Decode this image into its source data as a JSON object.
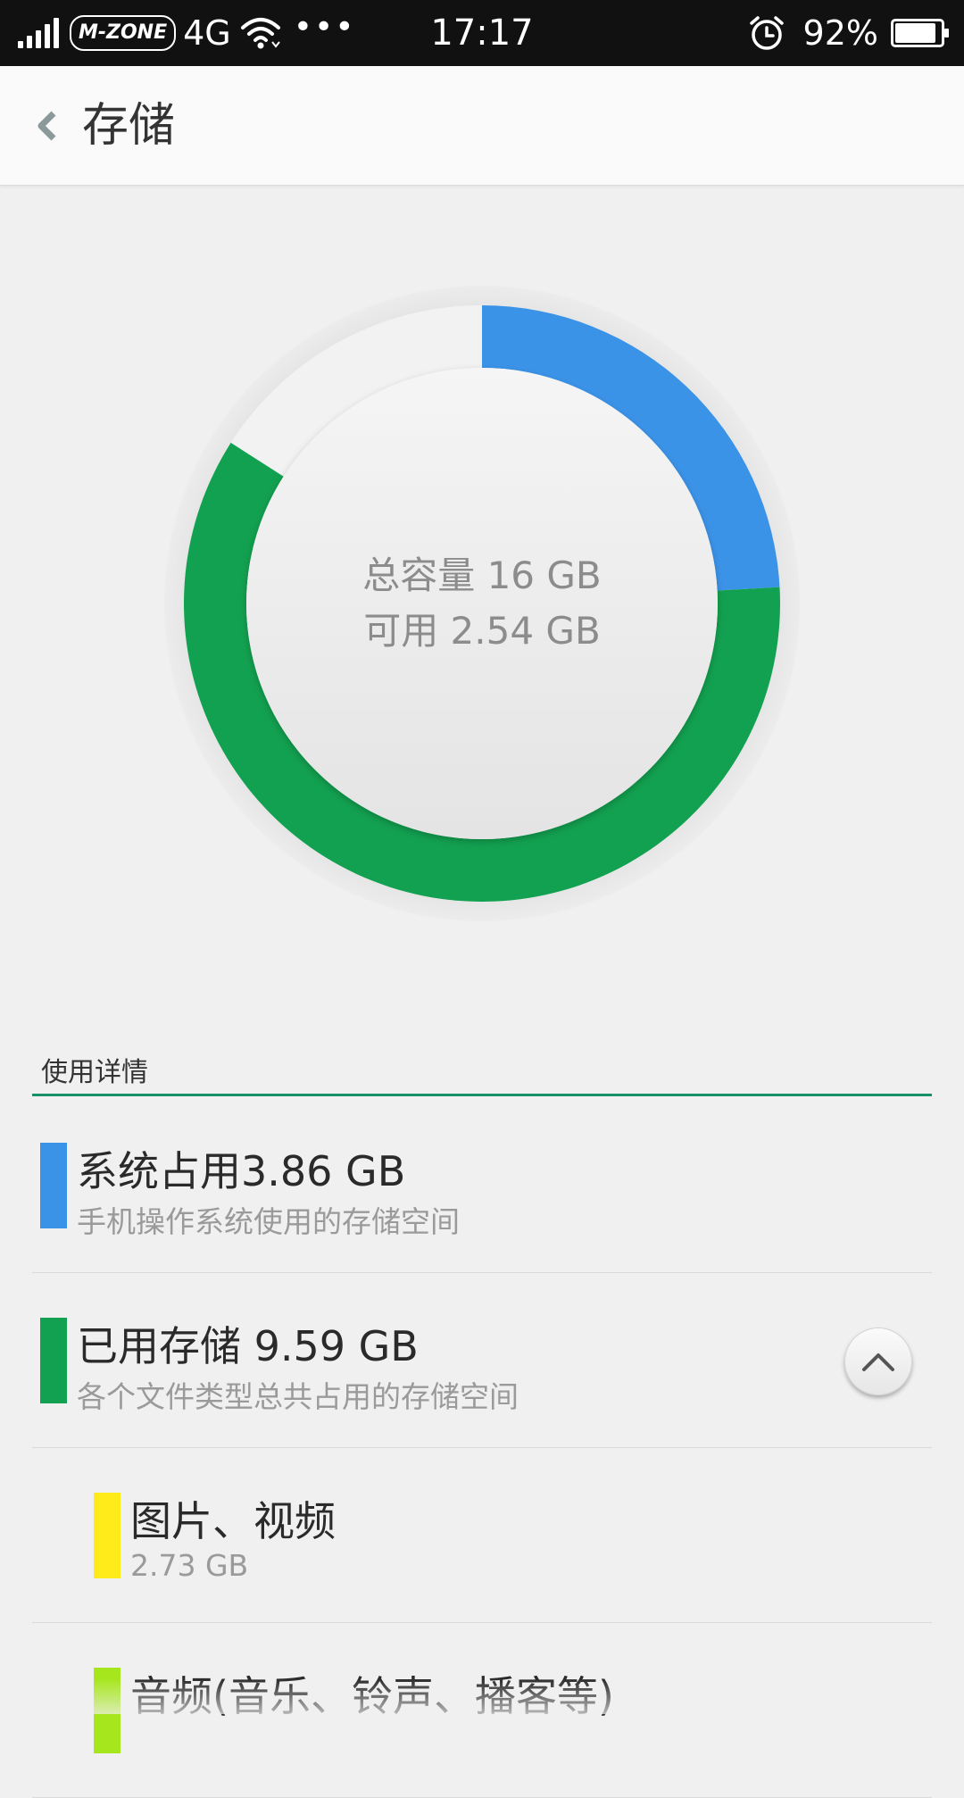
{
  "status_bar": {
    "carrier": "M-ZONE",
    "network": "4G",
    "time": "17:17",
    "battery_percent_text": "92%",
    "battery_level": 0.92,
    "icons": [
      "signal-icon",
      "wifi-icon",
      "more-icon",
      "alarm-icon",
      "battery-icon"
    ]
  },
  "header": {
    "title": "存储",
    "back_icon": "back-chevron-icon"
  },
  "chart": {
    "center_line1": "总容量 16 GB",
    "center_line2": "可用 2.54 GB"
  },
  "chart_data": {
    "type": "pie",
    "total_gb": 16,
    "segments": [
      {
        "label": "系统占用",
        "value": 3.86,
        "color": "#3b93e8"
      },
      {
        "label": "已用存储",
        "value": 9.59,
        "color": "#12a150"
      },
      {
        "label": "可用",
        "value": 2.54,
        "color": "#f2f2f2"
      }
    ]
  },
  "details": {
    "header": "使用详情",
    "items": [
      {
        "title": "系统占用3.86 GB",
        "subtitle": "手机操作系统使用的存储空间",
        "color": "#3b93e8"
      },
      {
        "title": "已用存储 9.59 GB",
        "subtitle": "各个文件类型总共占用的存储空间",
        "color": "#12a150"
      },
      {
        "title": "图片、视频",
        "subtitle": "2.73 GB",
        "color": "#ffeb1a"
      },
      {
        "title": "音频(音乐、铃声、播客等)",
        "subtitle": "",
        "color": "#a6e61c"
      }
    ],
    "collapse_icon": "chevron-up-icon"
  }
}
